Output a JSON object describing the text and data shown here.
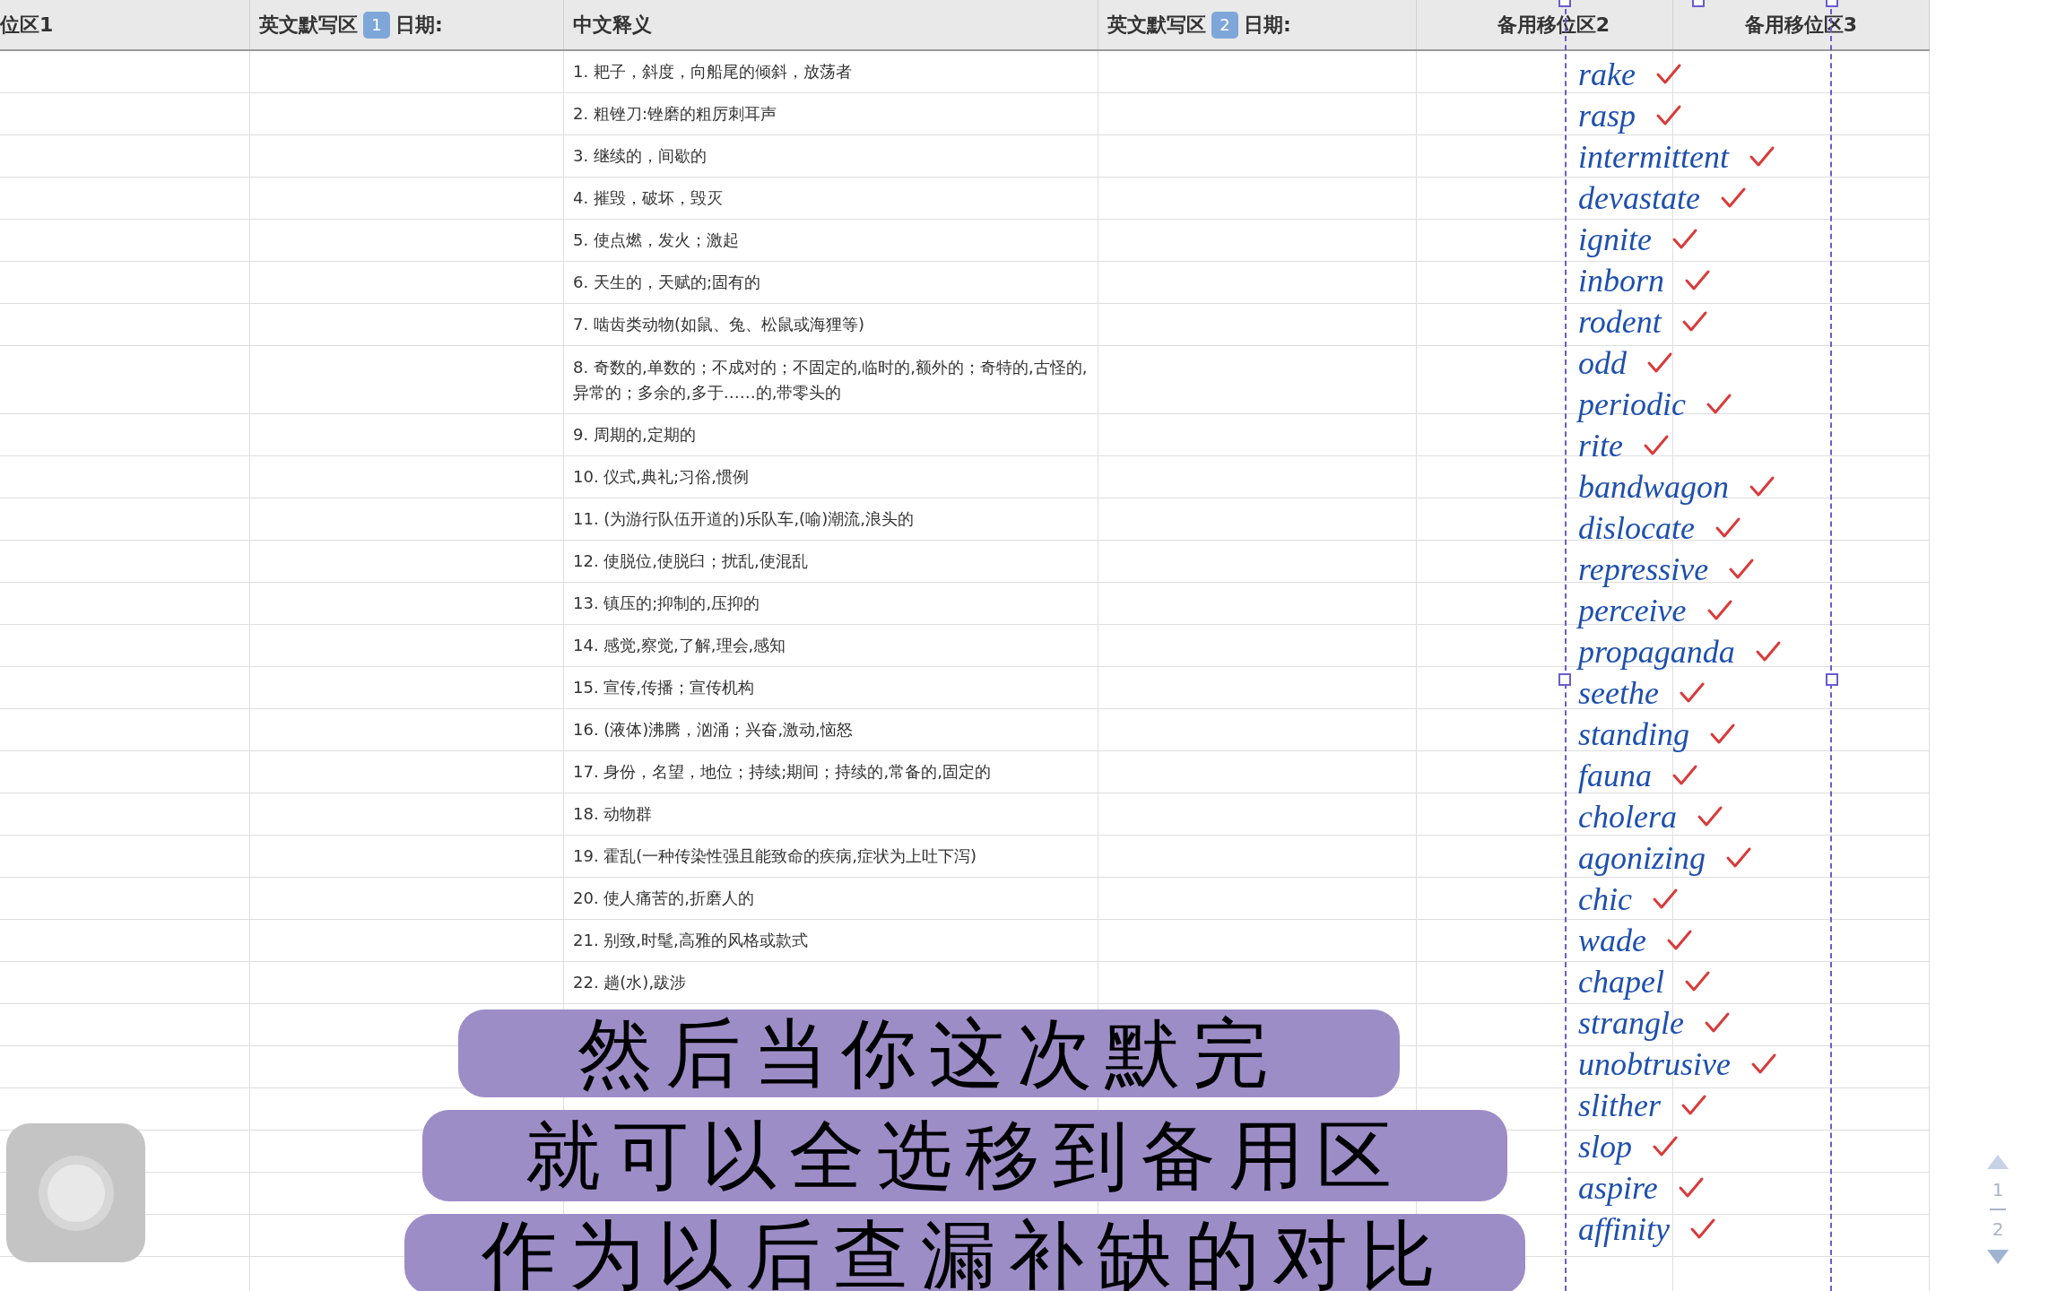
{
  "sheet": {
    "columns": [
      {
        "label": "位区1"
      },
      {
        "label": "英文默写区",
        "badge": "1",
        "suffix": "日期:"
      },
      {
        "label": "中文释义"
      },
      {
        "label": "英文默写区",
        "badge": "2",
        "suffix": "日期:"
      },
      {
        "label": "备用移位区2"
      },
      {
        "label": "备用移位区3"
      }
    ],
    "rows": [
      {
        "definition": "1. 耙子，斜度，向船尾的倾斜，放荡者"
      },
      {
        "definition": "2. 粗锉刀:锉磨的粗厉刺耳声"
      },
      {
        "definition": "3. 继续的，间歇的"
      },
      {
        "definition": "4. 摧毁，破坏，毁灭"
      },
      {
        "definition": "5. 使点燃，发火；激起"
      },
      {
        "definition": "6. 天生的，天赋的;固有的"
      },
      {
        "definition": "7. 啮齿类动物(如鼠、兔、松鼠或海狸等)"
      },
      {
        "definition": "8. 奇数的,单数的；不成对的；不固定的,临时的,额外的；奇特的,古怪的,异常的；多余的,多于……的,带零头的"
      },
      {
        "definition": "9. 周期的,定期的"
      },
      {
        "definition": "10. 仪式,典礼;习俗,惯例"
      },
      {
        "definition": "11. (为游行队伍开道的)乐队车,(喻)潮流,浪头的"
      },
      {
        "definition": "12. 使脱位,使脱臼；扰乱,使混乱"
      },
      {
        "definition": "13. 镇压的;抑制的,压抑的"
      },
      {
        "definition": "14. 感觉,察觉,了解,理会,感知"
      },
      {
        "definition": "15. 宣传,传播；宣传机构"
      },
      {
        "definition": "16. (液体)沸腾，汹涌；兴奋,激动,恼怒"
      },
      {
        "definition": "17. 身份，名望，地位；持续;期间；持续的,常备的,固定的"
      },
      {
        "definition": "18. 动物群"
      },
      {
        "definition": "19. 霍乱(一种传染性强且能致命的疾病,症状为上吐下泻)"
      },
      {
        "definition": "20. 使人痛苦的,折磨人的"
      },
      {
        "definition": "21. 别致,时髦,高雅的风格或款式"
      },
      {
        "definition": "22. 趟(水),跋涉"
      }
    ]
  },
  "handwriting": [
    "rake",
    "rasp",
    "intermittent",
    "devastate",
    "ignite",
    "inborn",
    "rodent",
    "odd",
    "periodic",
    "rite",
    "bandwagon",
    "dislocate",
    "repressive",
    "perceive",
    "propaganda",
    "seethe",
    "standing",
    "fauna",
    "cholera",
    "agonizing",
    "chic",
    "wade",
    "chapel",
    "strangle",
    "unobtrusive",
    "slither",
    "slop",
    "aspire",
    "affinity"
  ],
  "pager": {
    "current": "1",
    "total": "2"
  },
  "subtitles": [
    "然后当你这次默完",
    "就可以全选移到备用区",
    "作为以后查漏补缺的对比"
  ]
}
